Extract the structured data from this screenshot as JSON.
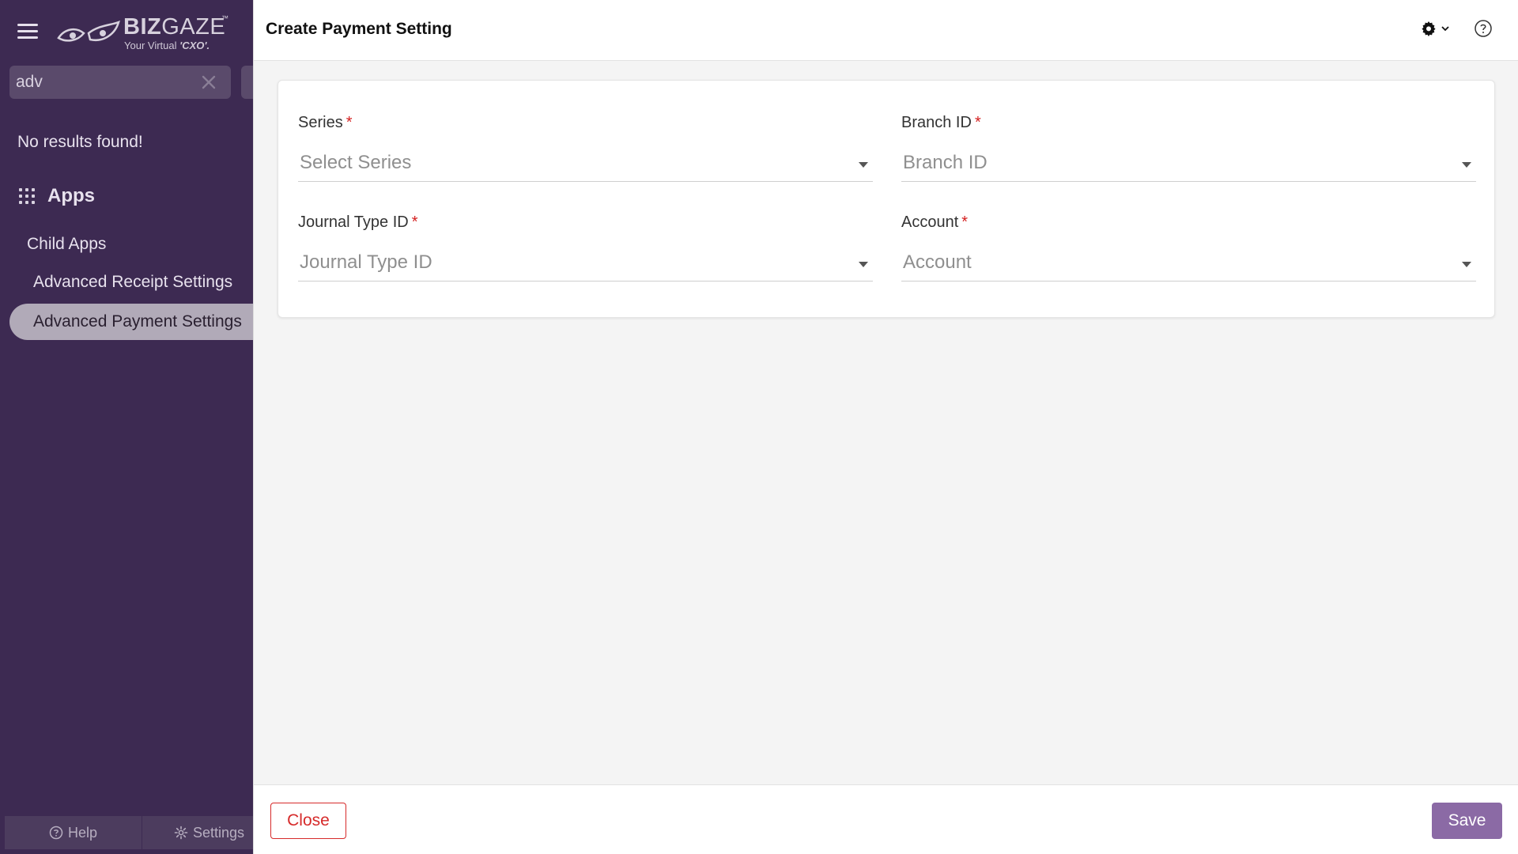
{
  "sidebar": {
    "logo": {
      "brand_bold": "BIZ",
      "brand_light": "GAZE",
      "tm": "™",
      "tagline_prefix": "Your Virtual ",
      "tagline_emph": "'CXO'."
    },
    "search": {
      "value": "adv",
      "placeholder": ""
    },
    "no_results": "No results found!",
    "apps_label": "Apps",
    "child_apps_label": "Child Apps",
    "items": [
      {
        "label": "Advanced Receipt Settings",
        "active": false
      },
      {
        "label": "Advanced Payment Settings",
        "active": true
      }
    ],
    "bottom": {
      "help_label": "Help",
      "settings_label": "Settings"
    }
  },
  "header": {
    "title": "Create Payment Setting"
  },
  "form": {
    "fields": [
      {
        "label": "Series",
        "placeholder": "Select Series",
        "required": true
      },
      {
        "label": "Branch ID",
        "placeholder": "Branch ID",
        "required": true
      },
      {
        "label": "Journal Type ID",
        "placeholder": "Journal Type ID",
        "required": true
      },
      {
        "label": "Account",
        "placeholder": "Account",
        "required": true
      }
    ],
    "required_mark": "*"
  },
  "footer": {
    "close_label": "Close",
    "save_label": "Save"
  },
  "colors": {
    "sidebar_bg": "#3d2a52",
    "active_item_bg": "#b1aab8",
    "save_bg": "#8b6aa5",
    "close_border": "#d62a2a",
    "required": "#d42020"
  }
}
